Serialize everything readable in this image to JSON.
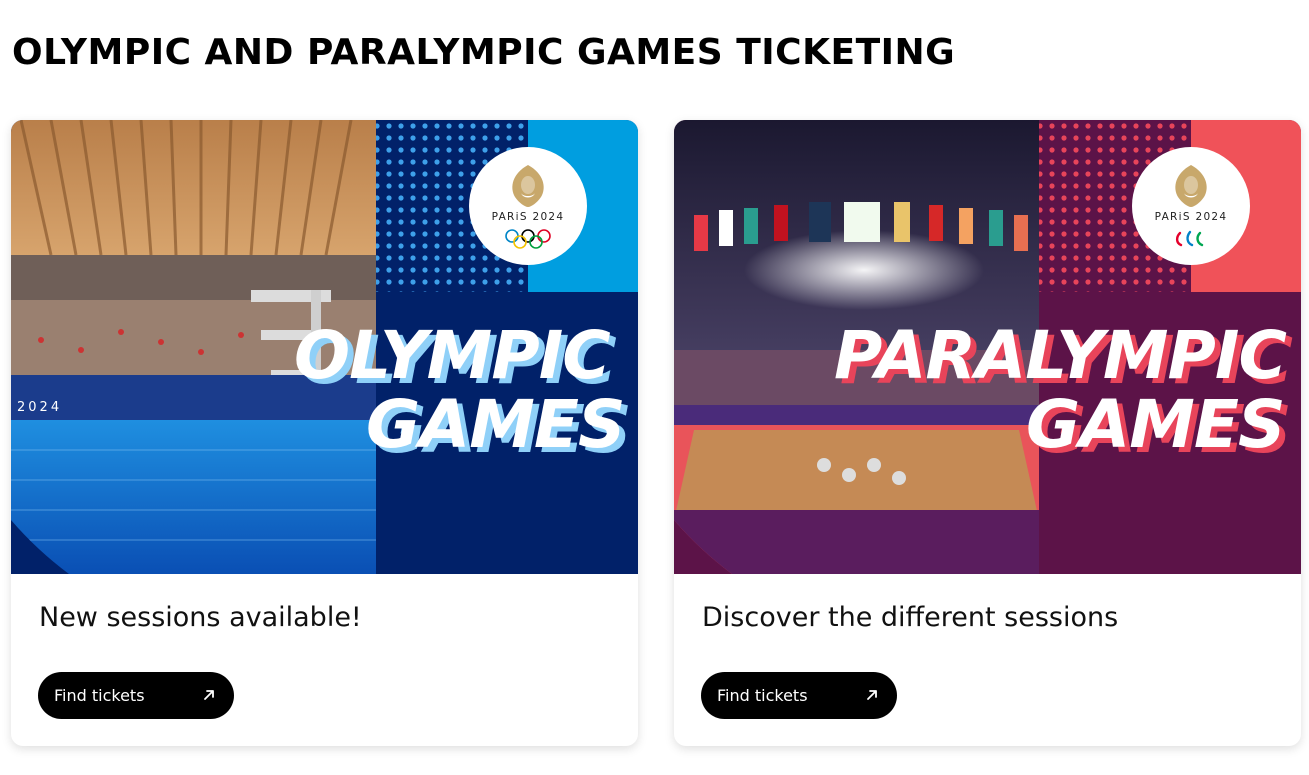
{
  "page": {
    "title": "OLYMPIC AND PARALYMPIC GAMES TICKETING"
  },
  "cards": [
    {
      "image": {
        "logo_text": "PARiS 2024",
        "symbol": "olympic-rings",
        "headline_line1": "OLYMPIC",
        "headline_line2": "GAMES",
        "venue_sign": "2024",
        "colors": {
          "panel": "#012169",
          "accent": "#009ee0",
          "shadow": "#8fd0f8"
        }
      },
      "heading": "New sessions available!",
      "button": {
        "label": "Find tickets",
        "icon": "arrow-up-right-icon"
      }
    },
    {
      "image": {
        "logo_text": "PARiS 2024",
        "symbol": "paralympic-agitos",
        "headline_line1": "PARALYMPIC",
        "headline_line2": "GAMES",
        "colors": {
          "panel": "#5c1348",
          "accent": "#f05259",
          "shadow": "#e8445a"
        }
      },
      "heading": "Discover the different sessions",
      "button": {
        "label": "Find tickets",
        "icon": "arrow-up-right-icon"
      }
    }
  ]
}
